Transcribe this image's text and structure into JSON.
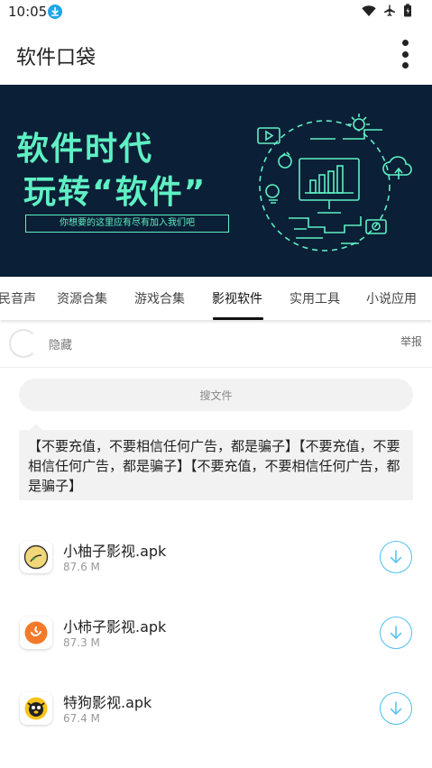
{
  "status_bar": {
    "time": "10:05",
    "icons": [
      "download-icon",
      "wifi-icon",
      "airplane-icon",
      "battery-icon"
    ]
  },
  "app_bar": {
    "title": "软件口袋",
    "menu_icon": "more-vert-icon"
  },
  "banner": {
    "line1": "软件时代",
    "line2": "玩转“软件”",
    "tagline": "你想要的这里应有尽有加入我们吧",
    "accent_color": "#5ff0c3",
    "background_color": "#0b1f36"
  },
  "tabs": {
    "items": [
      {
        "label": "民音声"
      },
      {
        "label": "资源合集"
      },
      {
        "label": "游戏合集"
      },
      {
        "label": "影视软件"
      },
      {
        "label": "实用工具"
      },
      {
        "label": "小说应用"
      }
    ],
    "active": "影视软件"
  },
  "user_row": {
    "name": "隐藏",
    "report_label": "举报"
  },
  "search": {
    "placeholder": "搜文件"
  },
  "notice": {
    "text": "【不要充值，不要相信任何广告，都是骗子】【不要充值，不要相信任何广告，都是骗子】【不要充值，不要相信任何广告，都是骗子】"
  },
  "files": [
    {
      "name": "小柚子影视.apk",
      "size": "87.6 M",
      "icon": "pomelo-app-icon"
    },
    {
      "name": "小柿子影视.apk",
      "size": "87.3 M",
      "icon": "persimmon-app-icon"
    },
    {
      "name": "特狗影视.apk",
      "size": "67.4 M",
      "icon": "dog-app-icon"
    }
  ],
  "colors": {
    "download_accent": "#4fc0ee",
    "text_primary": "#222222"
  }
}
